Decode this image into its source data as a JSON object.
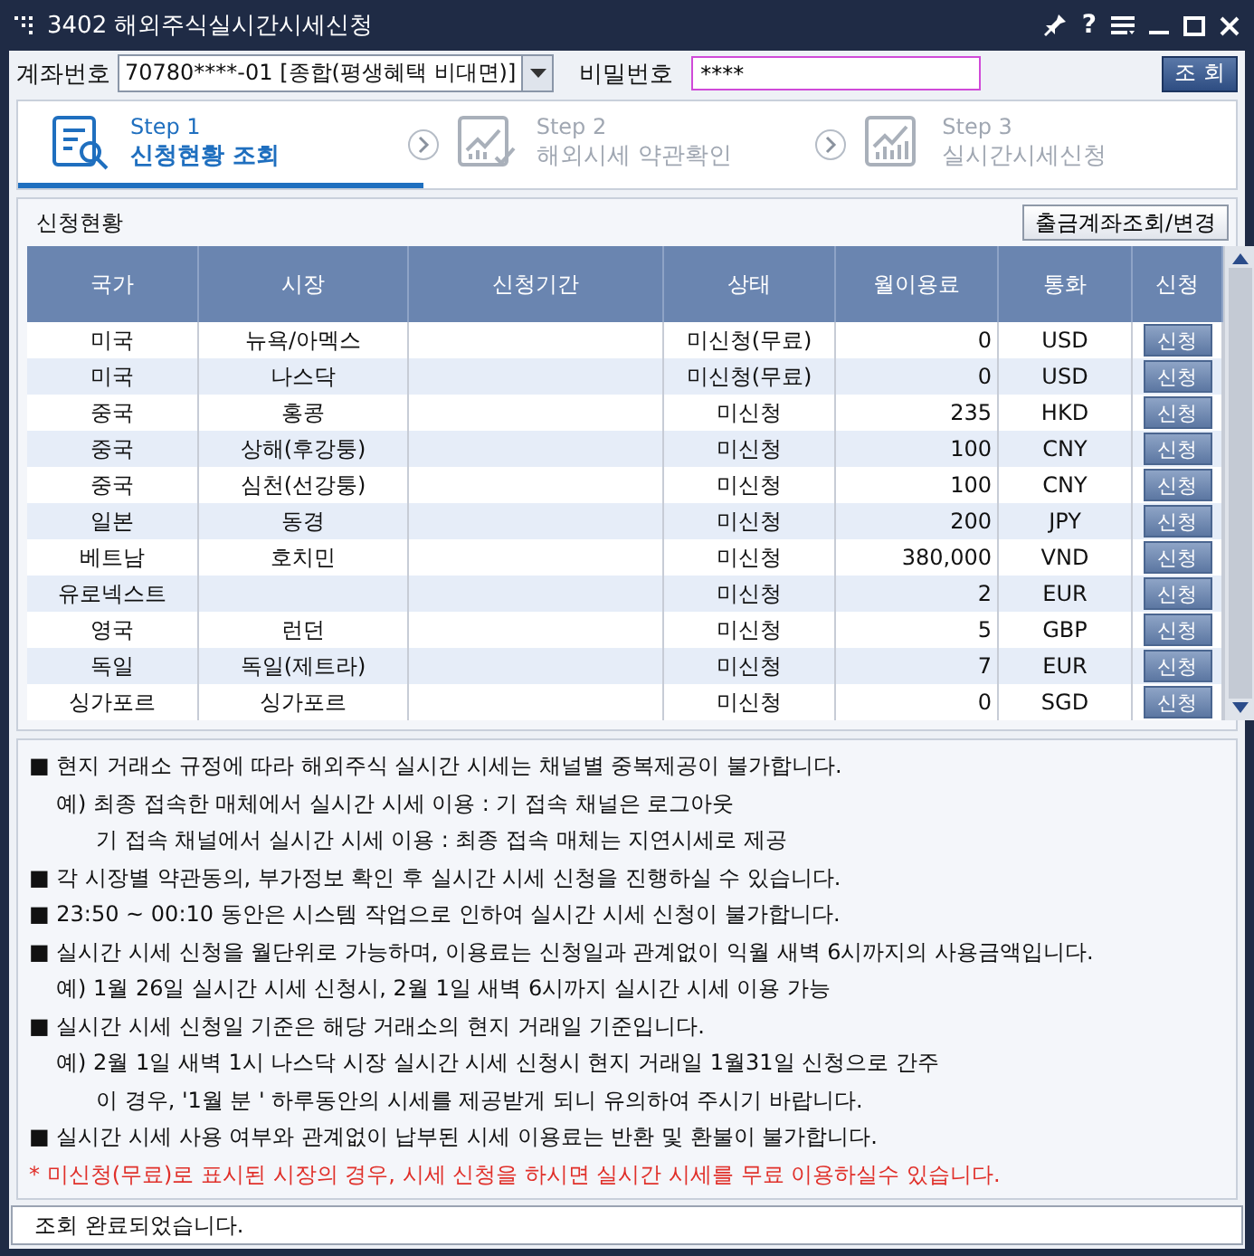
{
  "window": {
    "title": "3402 해외주식실시간시세신청",
    "help": "?"
  },
  "account": {
    "label": "계좌번호",
    "value": "70780****-01 [종합(평생혜택 비대면)]",
    "password_label": "비밀번호",
    "password": "****",
    "query_button": "조 회"
  },
  "steps": [
    {
      "step": "Step 1",
      "label": "신청현황 조회",
      "selected": true
    },
    {
      "step": "Step 2",
      "label": "해외시세 약관확인",
      "selected": false
    },
    {
      "step": "Step 3",
      "label": "실시간시세신청",
      "selected": false
    }
  ],
  "panel": {
    "title": "신청현황",
    "button": "출금계좌조회/변경"
  },
  "table": {
    "columns": [
      "국가",
      "시장",
      "신청기간",
      "상태",
      "월이용료",
      "통화",
      "신청"
    ],
    "rows": [
      {
        "cells": [
          "미국",
          "뉴욕/아멕스",
          "",
          "미신청(무료)",
          "0",
          "USD"
        ],
        "button": "신청"
      },
      {
        "cells": [
          "미국",
          "나스닥",
          "",
          "미신청(무료)",
          "0",
          "USD"
        ],
        "button": "신청"
      },
      {
        "cells": [
          "중국",
          "홍콩",
          "",
          "미신청",
          "235",
          "HKD"
        ],
        "button": "신청"
      },
      {
        "cells": [
          "중국",
          "상해(후강퉁)",
          "",
          "미신청",
          "100",
          "CNY"
        ],
        "button": "신청"
      },
      {
        "cells": [
          "중국",
          "심천(선강퉁)",
          "",
          "미신청",
          "100",
          "CNY"
        ],
        "button": "신청"
      },
      {
        "cells": [
          "일본",
          "동경",
          "",
          "미신청",
          "200",
          "JPY"
        ],
        "button": "신청"
      },
      {
        "cells": [
          "베트남",
          "호치민",
          "",
          "미신청",
          "380,000",
          "VND"
        ],
        "button": "신청"
      },
      {
        "cells": [
          "유로넥스트",
          "",
          "",
          "미신청",
          "2",
          "EUR"
        ],
        "button": "신청"
      },
      {
        "cells": [
          "영국",
          "런던",
          "",
          "미신청",
          "5",
          "GBP"
        ],
        "button": "신청"
      },
      {
        "cells": [
          "독일",
          "독일(제트라)",
          "",
          "미신청",
          "7",
          "EUR"
        ],
        "button": "신청"
      },
      {
        "cells": [
          "싱가포르",
          "싱가포르",
          "",
          "미신청",
          "0",
          "SGD"
        ],
        "button": "신청"
      }
    ]
  },
  "notes": [
    {
      "kind": "bullet",
      "text": "■ 현지 거래소 규정에 따라 해외주식 실시간 시세는 채널별 중복제공이 불가합니다."
    },
    {
      "kind": "example",
      "text": "예) 최종 접속한 매체에서 실시간 시세 이용 : 기 접속 채널은 로그아웃"
    },
    {
      "kind": "continuation",
      "text": "기 접속 채널에서 실시간 시세 이용 : 최종 접속 매체는 지연시세로 제공"
    },
    {
      "kind": "bullet",
      "text": "■ 각 시장별 약관동의, 부가정보 확인 후 실시간 시세 신청을 진행하실 수 있습니다."
    },
    {
      "kind": "bullet",
      "text": "■ 23:50 ~ 00:10 동안은 시스템 작업으로 인하여 실시간 시세 신청이 불가합니다."
    },
    {
      "kind": "bullet",
      "text": "■ 실시간 시세 신청을 월단위로 가능하며, 이용료는 신청일과 관계없이 익월 새벽 6시까지의 사용금액입니다."
    },
    {
      "kind": "example",
      "text": "예) 1월 26일 실시간 시세 신청시, 2월 1일 새벽 6시까지 실시간 시세 이용 가능"
    },
    {
      "kind": "bullet",
      "text": "■ 실시간 시세 신청일 기준은 해당 거래소의 현지 거래일 기준입니다."
    },
    {
      "kind": "example",
      "text": "예) 2월 1일 새벽 1시 나스닥 시장 실시간 시세 신청시 현지 거래일 1월31일 신청으로 간주"
    },
    {
      "kind": "continuation",
      "text": "이 경우, '1월 분 ' 하루동안의 시세를 제공받게 되니 유의하여 주시기 바랍니다."
    },
    {
      "kind": "bullet",
      "text": "■ 실시간 시세 사용 여부와 관계없이 납부된 시세 이용료는 반환 및 환불이 불가합니다."
    },
    {
      "kind": "warning",
      "text": "* 미신청(무료)로 표시된 시장의 경우, 시세 신청을 하시면 실시간 시세를 무료 이용하실수 있습니다."
    }
  ],
  "status_bar": "조회 완료되었습니다."
}
